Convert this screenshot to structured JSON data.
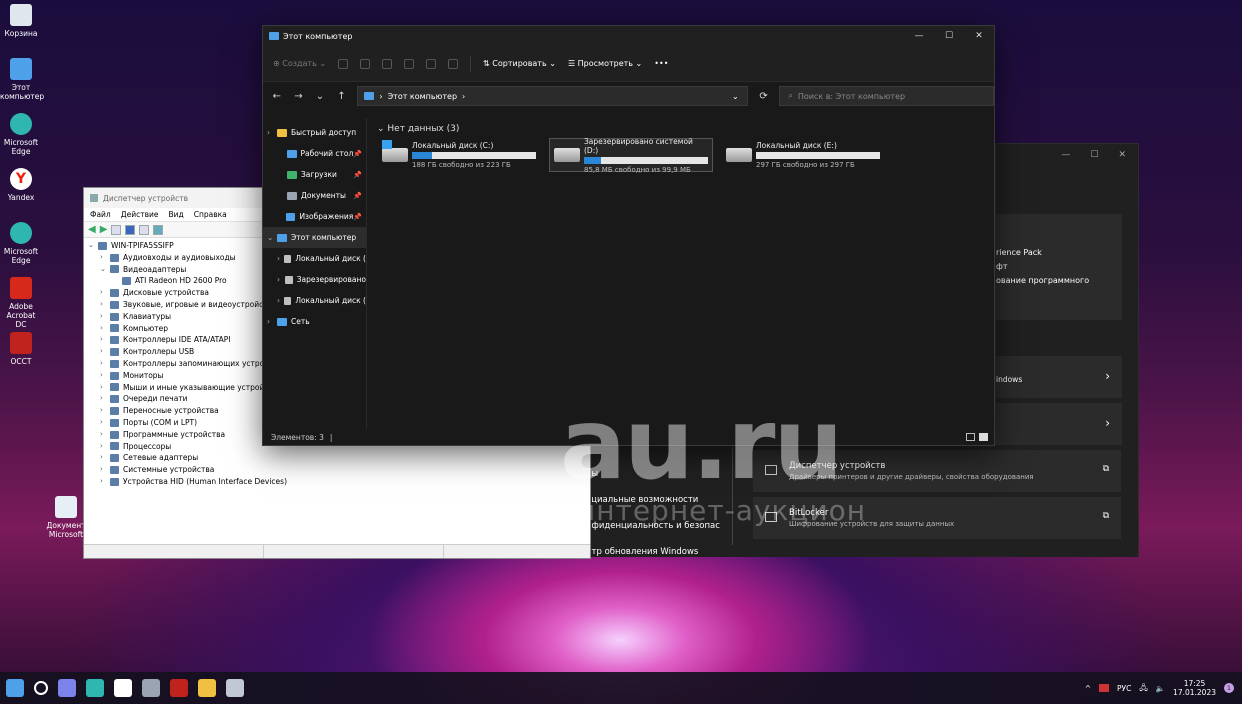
{
  "desktop": {
    "icons": [
      {
        "label": "Корзина",
        "icon": "recycle-bin-icon",
        "color": "#dfe6ee"
      },
      {
        "label": "Этот компьютер",
        "icon": "this-pc-icon",
        "color": "#4ea1e8"
      },
      {
        "label": "Microsoft Edge",
        "icon": "edge-icon",
        "color": "#2fb6b0"
      },
      {
        "label": "Yandex",
        "icon": "yandex-icon",
        "color": "#ffffff"
      },
      {
        "label": "Microsoft Edge",
        "icon": "edge-icon",
        "color": "#2fb6b0"
      },
      {
        "label": "Adobe Acrobat DC",
        "icon": "acrobat-icon",
        "color": "#d6291c"
      },
      {
        "label": "OCCT",
        "icon": "occt-icon",
        "color": "#c0221e"
      },
      {
        "label": "Документ Microsoft",
        "icon": "word-doc-icon",
        "color": "#e8eef6"
      }
    ]
  },
  "explorer": {
    "title": "Этот компьютер",
    "commands": {
      "create": "Создать",
      "sort": "Сортировать",
      "view": "Просмотреть",
      "more": "•••"
    },
    "address": "Этот компьютер",
    "search_placeholder": "Поиск в: Этот компьютер",
    "nav": [
      {
        "label": "Быстрый доступ",
        "icon": "star-icon",
        "color": "#f0c040",
        "pinned": false,
        "indent": 0,
        "expander": "›"
      },
      {
        "label": "Рабочий стол",
        "icon": "desktop-folder-icon",
        "color": "#4ea1e8",
        "pinned": true,
        "indent": 1,
        "expander": ""
      },
      {
        "label": "Загрузки",
        "icon": "downloads-icon",
        "color": "#3fb16a",
        "pinned": true,
        "indent": 1,
        "expander": ""
      },
      {
        "label": "Документы",
        "icon": "documents-icon",
        "color": "#9aa4b2",
        "pinned": true,
        "indent": 1,
        "expander": ""
      },
      {
        "label": "Изображения",
        "icon": "pictures-icon",
        "color": "#4ea1e8",
        "pinned": true,
        "indent": 1,
        "expander": ""
      },
      {
        "label": "Этот компьютер",
        "icon": "this-pc-icon",
        "color": "#4ea1e8",
        "pinned": false,
        "indent": 0,
        "expander": "⌄",
        "selected": true
      },
      {
        "label": "Локальный диск (",
        "icon": "drive-icon",
        "color": "#bfbfbf",
        "pinned": false,
        "indent": 1,
        "expander": "›"
      },
      {
        "label": "Зарезервировано",
        "icon": "drive-icon",
        "color": "#bfbfbf",
        "pinned": false,
        "indent": 1,
        "expander": "›"
      },
      {
        "label": "Локальный диск (",
        "icon": "drive-icon",
        "color": "#bfbfbf",
        "pinned": false,
        "indent": 1,
        "expander": "›"
      },
      {
        "label": "Сеть",
        "icon": "network-icon",
        "color": "#4ea1e8",
        "pinned": false,
        "indent": 0,
        "expander": "›"
      }
    ],
    "group_header": "Нет данных (3)",
    "drives": [
      {
        "name": "Локальный диск (C:)",
        "free": "188 ГБ свободно из 223 ГБ",
        "used_fraction": 0.16,
        "windows_logo": true,
        "selected": false
      },
      {
        "name": "Зарезервировано системой (D:)",
        "free": "85,8 МБ свободно из 99,9 МБ",
        "used_fraction": 0.14,
        "windows_logo": false,
        "selected": true
      },
      {
        "name": "Локальный диск (E:)",
        "free": "297 ГБ свободно из 297 ГБ",
        "used_fraction": 0.0,
        "windows_logo": false,
        "selected": false
      }
    ],
    "status": "Элементов: 3"
  },
  "device_manager": {
    "title": "Диспетчер устройств",
    "menu": [
      "Файл",
      "Действие",
      "Вид",
      "Справка"
    ],
    "root": "WIN-TPIFA5SSIFP",
    "tree": [
      {
        "label": "Аудиовходы и аудиовыходы",
        "expander": "›",
        "level": 1
      },
      {
        "label": "Видеоадаптеры",
        "expander": "⌄",
        "level": 1
      },
      {
        "label": "ATI Radeon HD 2600 Pro",
        "expander": "",
        "level": 2
      },
      {
        "label": "Дисковые устройства",
        "expander": "›",
        "level": 1
      },
      {
        "label": "Звуковые, игровые и видеоустройства",
        "expander": "›",
        "level": 1
      },
      {
        "label": "Клавиатуры",
        "expander": "›",
        "level": 1
      },
      {
        "label": "Компьютер",
        "expander": "›",
        "level": 1
      },
      {
        "label": "Контроллеры IDE ATA/ATAPI",
        "expander": "›",
        "level": 1
      },
      {
        "label": "Контроллеры USB",
        "expander": "›",
        "level": 1
      },
      {
        "label": "Контроллеры запоминающих устройств",
        "expander": "›",
        "level": 1
      },
      {
        "label": "Мониторы",
        "expander": "›",
        "level": 1
      },
      {
        "label": "Мыши и иные указывающие устройства",
        "expander": "›",
        "level": 1
      },
      {
        "label": "Очереди печати",
        "expander": "›",
        "level": 1
      },
      {
        "label": "Переносные устройства",
        "expander": "›",
        "level": 1
      },
      {
        "label": "Порты (COM и LPT)",
        "expander": "›",
        "level": 1
      },
      {
        "label": "Программные устройства",
        "expander": "›",
        "level": 1
      },
      {
        "label": "Процессоры",
        "expander": "›",
        "level": 1
      },
      {
        "label": "Сетевые адаптеры",
        "expander": "›",
        "level": 1
      },
      {
        "label": "Системные устройства",
        "expander": "›",
        "level": 1
      },
      {
        "label": "Устройства HID (Human Interface Devices)",
        "expander": "›",
        "level": 1
      }
    ]
  },
  "settings": {
    "fragments": [
      "rience Pack",
      "фт",
      "ование программного",
      "indows"
    ],
    "left_items": [
      "ры",
      "ециальные возможности",
      "нфиденциальность и безопас",
      "нтр обновления Windows"
    ],
    "cards": [
      {
        "title": "Диспетчер устройств",
        "subtitle": "Драйверы принтеров и другие драйверы, свойства оборудования"
      },
      {
        "title": "BitLocker",
        "subtitle": "Шифрование устройств для защиты данных"
      }
    ]
  },
  "watermark": {
    "main": "au.ru",
    "sub": "интернет-аукцион"
  },
  "taskbar": {
    "apps": [
      {
        "icon": "start-icon",
        "color": "#4ea1e8"
      },
      {
        "icon": "search-icon",
        "color": "#ffffff"
      },
      {
        "icon": "chat-icon",
        "color": "#7b83eb"
      },
      {
        "icon": "edge-icon",
        "color": "#2fb6b0"
      },
      {
        "icon": "yandex-icon",
        "color": "#ffffff"
      },
      {
        "icon": "settings-icon",
        "color": "#9aa4b2"
      },
      {
        "icon": "occt-icon",
        "color": "#c0221e"
      },
      {
        "icon": "file-explorer-icon",
        "color": "#f0c040"
      },
      {
        "icon": "device-manager-icon",
        "color": "#bfc8d4"
      }
    ],
    "lang": "РУС",
    "time": "17:25",
    "date": "17.01.2023",
    "notification_count": "1"
  }
}
